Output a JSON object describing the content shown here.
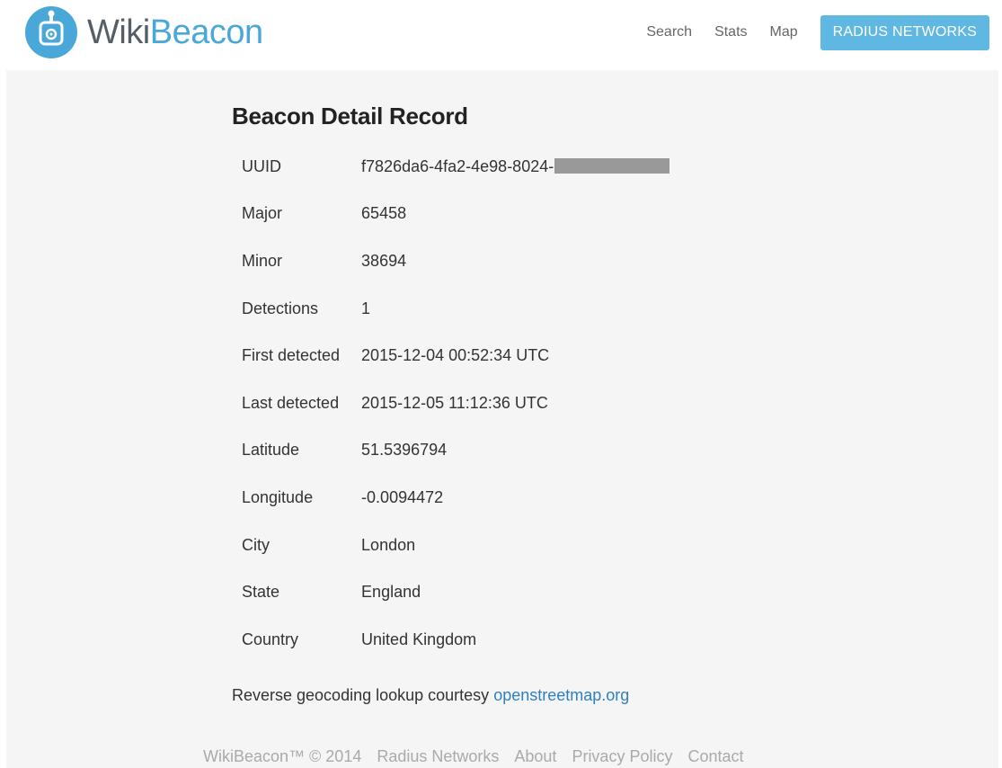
{
  "brand": {
    "name_part1": "Wiki",
    "name_part2": "Beacon",
    "logo_icon": "beacon-device-icon",
    "logo_color": "#4aa8d8"
  },
  "nav": {
    "links": [
      "Search",
      "Stats",
      "Map"
    ],
    "button_label": "RADIUS NETWORKS",
    "button_color": "#5fb8e2"
  },
  "record": {
    "title": "Beacon Detail Record",
    "rows": [
      {
        "label": "UUID",
        "value": "f7826da6-4fa2-4e98-8024-"
      },
      {
        "label": "Major",
        "value": "65458"
      },
      {
        "label": "Minor",
        "value": "38694"
      },
      {
        "label": "Detections",
        "value": "1"
      },
      {
        "label": "First detected",
        "value": "2015-12-04 00:52:34 UTC"
      },
      {
        "label": "Last detected",
        "value": "2015-12-05 11:12:36 UTC"
      },
      {
        "label": "Latitude",
        "value": "51.5396794"
      },
      {
        "label": "Longitude",
        "value": "-0.0094472"
      },
      {
        "label": "City",
        "value": "London"
      },
      {
        "label": "State",
        "value": "England"
      },
      {
        "label": "Country",
        "value": "United Kingdom"
      }
    ]
  },
  "credit": {
    "text": "Reverse geocoding lookup courtesy ",
    "link": "openstreetmap.org"
  },
  "footer": {
    "copyright": "WikiBeacon™ © 2014",
    "links": [
      "Radius Networks",
      "About",
      "Privacy Policy",
      "Contact"
    ]
  }
}
